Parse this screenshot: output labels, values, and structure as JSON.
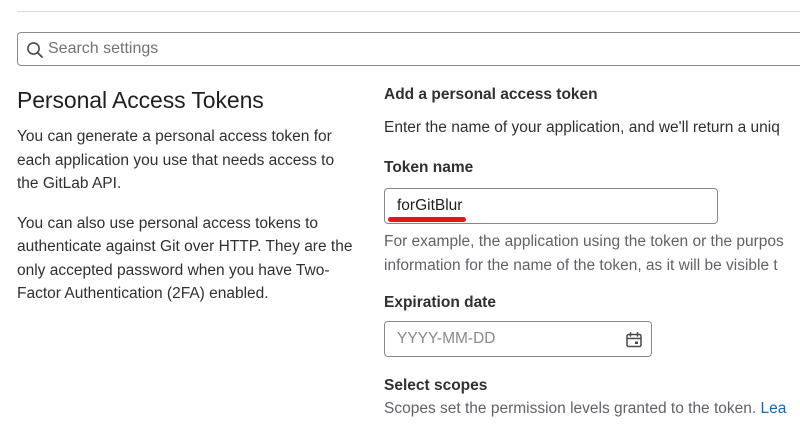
{
  "search": {
    "placeholder": "Search settings"
  },
  "intro": {
    "title": "Personal Access Tokens",
    "paragraph_1": "You can generate a personal access token for each application you use that needs access to the GitLab API.",
    "paragraph_2": "You can also use personal access tokens to authenticate against Git over HTTP. They are the only accepted password when you have Two-Factor Authentication (2FA) enabled."
  },
  "form": {
    "heading": "Add a personal access token",
    "intro": "Enter the name of your application, and we'll return a uniq",
    "token_name": {
      "label": "Token name",
      "value": "forGitBlur",
      "help_line_1": "For example, the application using the token or the purpos",
      "help_line_2": "information for the name of the token, as it will be visible t"
    },
    "expiration": {
      "label": "Expiration date",
      "placeholder": "YYYY-MM-DD"
    },
    "scopes": {
      "label": "Select scopes",
      "description": "Scopes set the permission levels granted to the token.",
      "link_text": "Lea"
    }
  },
  "colors": {
    "annotation_underline": "#e8141c",
    "link": "#1068bf",
    "input_border": "#89888d"
  },
  "icons": {
    "search": "search-icon",
    "calendar": "calendar-icon"
  }
}
